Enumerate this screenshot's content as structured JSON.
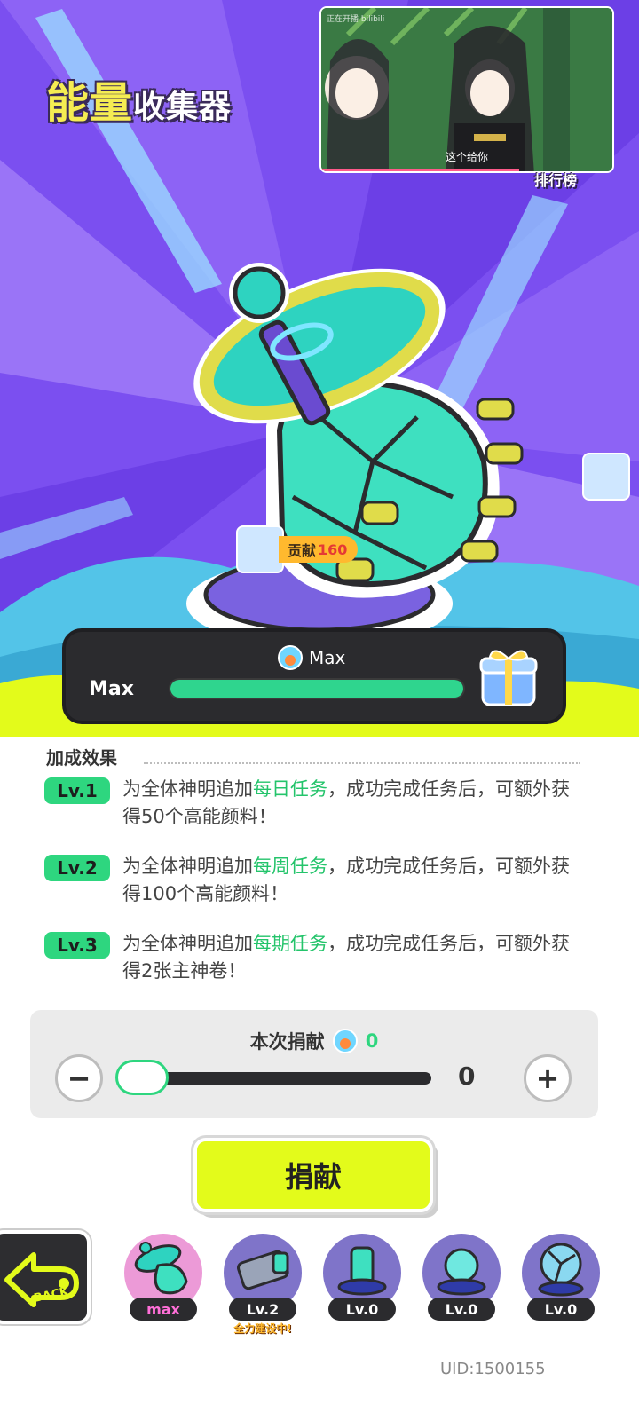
{
  "header": {
    "title_big": "能量",
    "title_small": "收集器",
    "ranking_label": "排行榜"
  },
  "video": {
    "watermark": "正在开播 bilibili",
    "caption": "这个给你",
    "progress_fraction": 0.68
  },
  "contribution": {
    "label": "贡献",
    "value": "160"
  },
  "progress": {
    "top_label": "Max",
    "left_label": "Max",
    "fill_fraction": 1.0,
    "accent": "#2fd58e"
  },
  "bonus": {
    "heading": "加成效果",
    "levels": [
      {
        "badge": "Lv.1",
        "pre": "为全体神明追加",
        "highlight": "每日任务",
        "post": "，成功完成任务后，可额外获得50个高能颜料！"
      },
      {
        "badge": "Lv.2",
        "pre": "为全体神明追加",
        "highlight": "每周任务",
        "post": "，成功完成任务后，可额外获得100个高能颜料！"
      },
      {
        "badge": "Lv.3",
        "pre": "为全体神明追加",
        "highlight": "每期任务",
        "post": "，成功完成任务后，可额外获得2张主神卷！"
      }
    ]
  },
  "donation": {
    "title": "本次捐献",
    "amount": "0",
    "slider_value": "0",
    "minus_label": "−",
    "plus_label": "+",
    "button_label": "捐献"
  },
  "bottom_bar": {
    "back_label": "BACK",
    "buildings": [
      {
        "level": "max",
        "tag": ""
      },
      {
        "level": "Lv.2",
        "tag": "全力建设中!"
      },
      {
        "level": "Lv.0",
        "tag": ""
      },
      {
        "level": "Lv.0",
        "tag": ""
      },
      {
        "level": "Lv.0",
        "tag": ""
      }
    ]
  },
  "footer": {
    "uid": "UID:1500155"
  },
  "colors": {
    "bg_purple": "#7b4ff0",
    "lime": "#e3fb1b",
    "green": "#2ed67f",
    "dark": "#2b2b2e"
  }
}
